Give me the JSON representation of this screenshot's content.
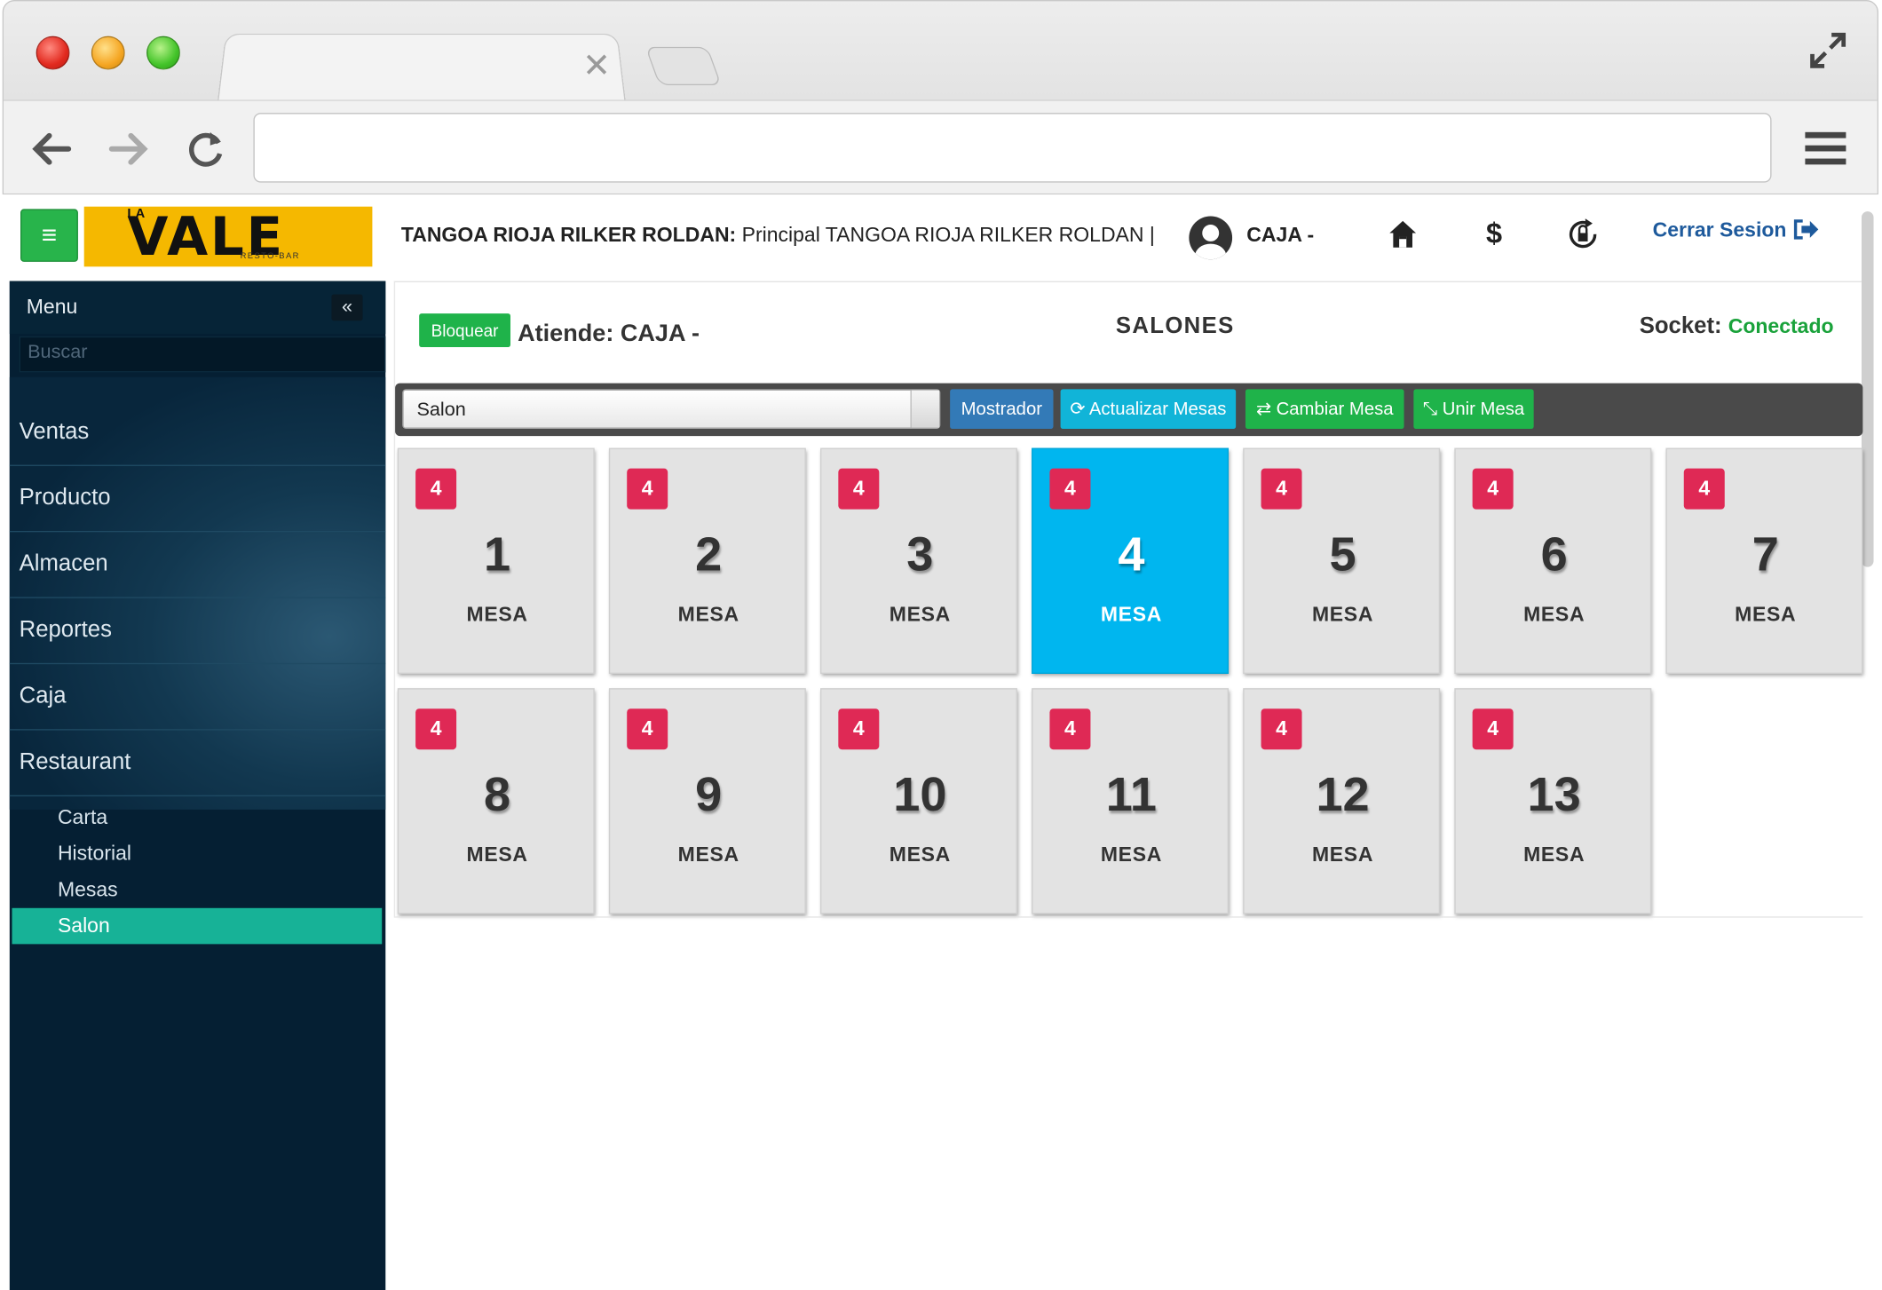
{
  "header": {
    "user_bold": "TANGOA RIOJA RILKER ROLDAN:",
    "user_detail": "Principal TANGOA RIOJA RILKER ROLDAN |",
    "caja": "CAJA -",
    "logout": "Cerrar Sesion"
  },
  "logo": {
    "la": "LA",
    "name": "VALE",
    "sub": "RESTO-BAR"
  },
  "sidebar": {
    "title": "Menu",
    "search_placeholder": "Buscar",
    "items": [
      {
        "label": "Ventas"
      },
      {
        "label": "Producto"
      },
      {
        "label": "Almacen"
      },
      {
        "label": "Reportes"
      },
      {
        "label": "Caja"
      },
      {
        "label": "Restaurant"
      }
    ],
    "subitems": [
      {
        "label": "Carta"
      },
      {
        "label": "Historial"
      },
      {
        "label": "Mesas"
      },
      {
        "label": "Salon",
        "active": true
      }
    ]
  },
  "panel": {
    "lock_label": "Bloquear",
    "atiende": "Atiende: CAJA -",
    "title": "SALONES",
    "socket_label": "Socket:",
    "socket_status": "Conectado",
    "socket_color": "#1aa23b"
  },
  "toolbar": {
    "select_value": "Salon",
    "mostrador": "Mostrador",
    "actualizar": "Actualizar Mesas",
    "cambiar": "Cambiar Mesa",
    "unir": "Unir Mesa"
  },
  "mesas": [
    {
      "badge": "4",
      "number": "1",
      "label": "MESA"
    },
    {
      "badge": "4",
      "number": "2",
      "label": "MESA"
    },
    {
      "badge": "4",
      "number": "3",
      "label": "MESA"
    },
    {
      "badge": "4",
      "number": "4",
      "label": "MESA",
      "selected": true
    },
    {
      "badge": "4",
      "number": "5",
      "label": "MESA"
    },
    {
      "badge": "4",
      "number": "6",
      "label": "MESA"
    },
    {
      "badge": "4",
      "number": "7",
      "label": "MESA"
    },
    {
      "badge": "4",
      "number": "8",
      "label": "MESA"
    },
    {
      "badge": "4",
      "number": "9",
      "label": "MESA"
    },
    {
      "badge": "4",
      "number": "10",
      "label": "MESA"
    },
    {
      "badge": "4",
      "number": "11",
      "label": "MESA"
    },
    {
      "badge": "4",
      "number": "12",
      "label": "MESA"
    },
    {
      "badge": "4",
      "number": "13",
      "label": "MESA"
    }
  ],
  "colors": {
    "sidebar_bg": "#051f33",
    "sidebar_active": "#17b297",
    "badge": "#df2955",
    "selected_table": "#00b6ef",
    "green_button": "#1fb34a",
    "cyan_button": "#11b4d8",
    "blue_button": "#337ab7"
  }
}
